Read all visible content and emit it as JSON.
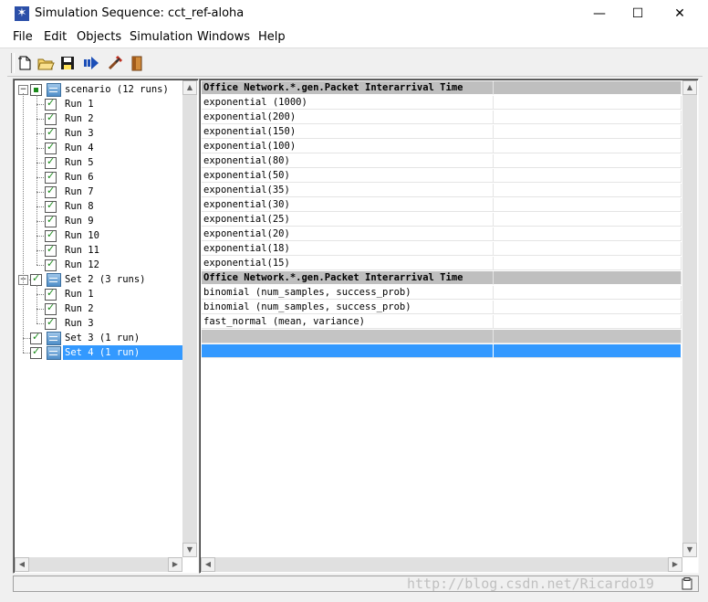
{
  "window": {
    "title": "Simulation Sequence: cct_ref-aloha",
    "minimize_glyph": "—",
    "maximize_glyph": "☐",
    "close_glyph": "✕",
    "app_icon": "star-icon"
  },
  "menu": {
    "items": [
      "File",
      "Edit",
      "Objects",
      "Simulation",
      "Windows",
      "Help"
    ]
  },
  "toolbar": {
    "buttons": [
      "new-document-icon",
      "open-folder-icon",
      "save-disk-icon",
      "run-simulation-icon",
      "delete-run-icon",
      "exit-door-icon"
    ]
  },
  "tree": {
    "root": {
      "label": "scenario (12 runs)",
      "expander": "⊟"
    },
    "root_runs": [
      "Run 1",
      "Run 2",
      "Run 3",
      "Run 4",
      "Run 5",
      "Run 6",
      "Run 7",
      "Run 8",
      "Run 9",
      "Run 10",
      "Run 11",
      "Run 12"
    ],
    "set2": {
      "label": "Set 2 (3 runs)",
      "expander": "⊟"
    },
    "set2_runs": [
      "Run 1",
      "Run 2",
      "Run 3"
    ],
    "set3": {
      "label": "Set 3 (1 run)"
    },
    "set4": {
      "label": "Set 4 (1 run)",
      "selected": true
    }
  },
  "grid": {
    "header1": "Office Network.*.gen.Packet Interarrival Time",
    "rows1": [
      "exponential (1000)",
      "exponential(200)",
      "exponential(150)",
      "exponential(100)",
      "exponential(80)",
      "exponential(50)",
      "exponential(35)",
      "exponential(30)",
      "exponential(25)",
      "exponential(20)",
      "exponential(18)",
      "exponential(15)"
    ],
    "header2": "Office Network.*.gen.Packet Interarrival Time",
    "rows2": [
      "binomial (num_samples, success_prob)",
      "binomial (num_samples, success_prob)",
      "fast_normal (mean, variance)"
    ]
  },
  "colors": {
    "selection": "#3399ff",
    "header_gray": "#bfbfbf",
    "check_green": "#1a8a1a"
  },
  "watermark": "http://blog.csdn.net/Ricardo19"
}
